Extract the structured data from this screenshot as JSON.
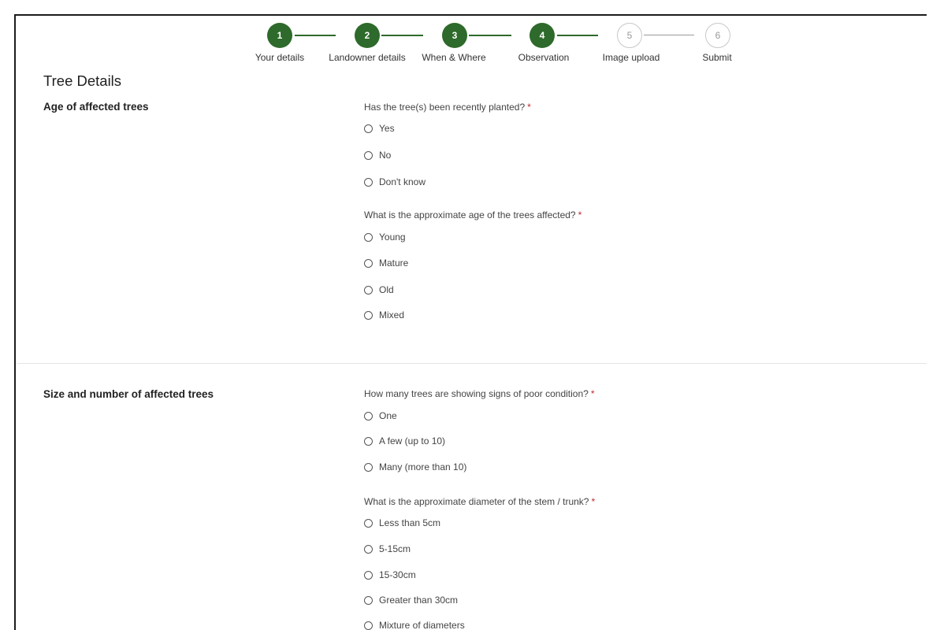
{
  "stepper": {
    "steps": [
      {
        "number": "1",
        "label": "Your details",
        "status": "complete"
      },
      {
        "number": "2",
        "label": "Landowner details",
        "status": "complete"
      },
      {
        "number": "3",
        "label": "When & Where",
        "status": "complete"
      },
      {
        "number": "4",
        "label": "Observation",
        "status": "current"
      },
      {
        "number": "5",
        "label": "Image upload",
        "status": "upcoming"
      },
      {
        "number": "6",
        "label": "Submit",
        "status": "upcoming"
      }
    ],
    "complete_color": "#2e6a2b",
    "upcoming_color": "#c8c8c8"
  },
  "page_title": "Tree Details",
  "sections": [
    {
      "title": "Age of affected trees",
      "questions": [
        {
          "label": "Has the tree(s) been recently planted?",
          "required_marker": "*",
          "options": [
            "Yes",
            "No",
            "Don't know"
          ]
        },
        {
          "label": "What is the approximate age of the trees affected?",
          "required_marker": "*",
          "options": [
            "Young",
            "Mature",
            "Old",
            "Mixed"
          ]
        }
      ]
    },
    {
      "title": "Size and number of affected trees",
      "questions": [
        {
          "label": "How many trees are showing signs of poor condition?",
          "required_marker": "*",
          "options": [
            "One",
            "A few (up to 10)",
            "Many (more than 10)"
          ]
        },
        {
          "label": "What is the approximate diameter of the stem / trunk?",
          "required_marker": "*",
          "options": [
            "Less than 5cm",
            "5-15cm",
            "15-30cm",
            "Greater than 30cm",
            "Mixture of diameters"
          ]
        }
      ]
    }
  ],
  "colors": {
    "required": "#c0282d",
    "accent": "#2e6a2b"
  }
}
